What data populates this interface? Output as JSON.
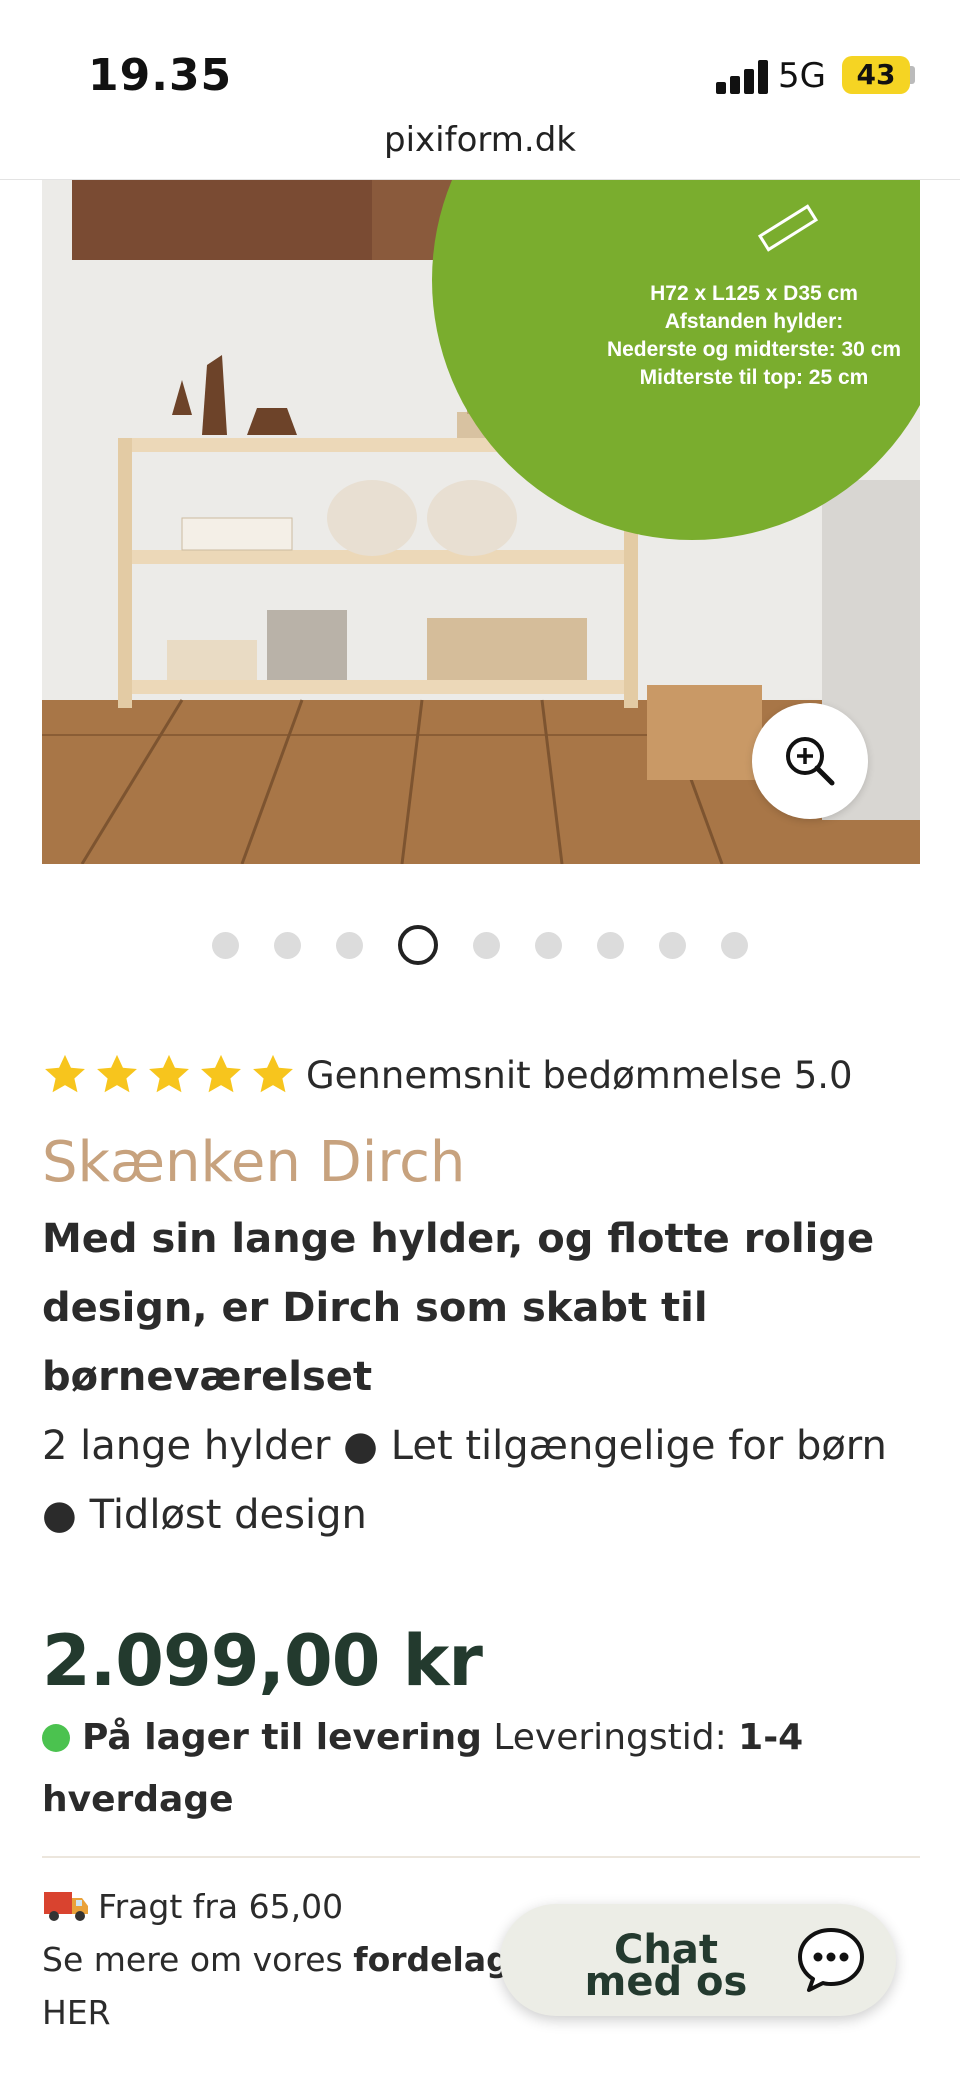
{
  "status_bar": {
    "time": "19.35",
    "network": "5G",
    "battery": "43"
  },
  "browser": {
    "url": "pixiform.dk"
  },
  "gallery": {
    "badge": {
      "line1": "H72 x L125 x D35 cm",
      "line2": "Afstanden hylder:",
      "line3": "Nederste og midterste: 30 cm",
      "line4": "Midterste til top: 25 cm"
    },
    "dot_count": 9,
    "active_index": 3,
    "zoom_icon": "zoom-in-icon"
  },
  "rating": {
    "stars": 5,
    "text": "Gennemsnit bedømmelse 5.0"
  },
  "product": {
    "title": "Skænken Dirch",
    "subtitle": "Med sin lange hylder, og flotte rolige design, er Dirch som skabt til børneværelset",
    "features": "2 lange hylder ● Let tilgængelige for børn ● Tidløst design",
    "price": "2.099,00 kr"
  },
  "stock": {
    "status": "På lager til levering",
    "label": "Leveringstid:",
    "time_1": "1-4",
    "time_2": "hverdage"
  },
  "shipping": {
    "icon": "delivery-truck-icon",
    "text": "Fragt fra 65,00",
    "more_prefix": "Se mere om vores",
    "more_bold": "fordelagtige",
    "here": "HER"
  },
  "chat": {
    "label": "Chat med os",
    "icon": "chat-bubble-icon"
  },
  "colors": {
    "title": "#c7a27e",
    "price": "#233a2e",
    "badge": "#7aad2e",
    "stock": "#4bc24f",
    "star": "#f7c51d"
  }
}
